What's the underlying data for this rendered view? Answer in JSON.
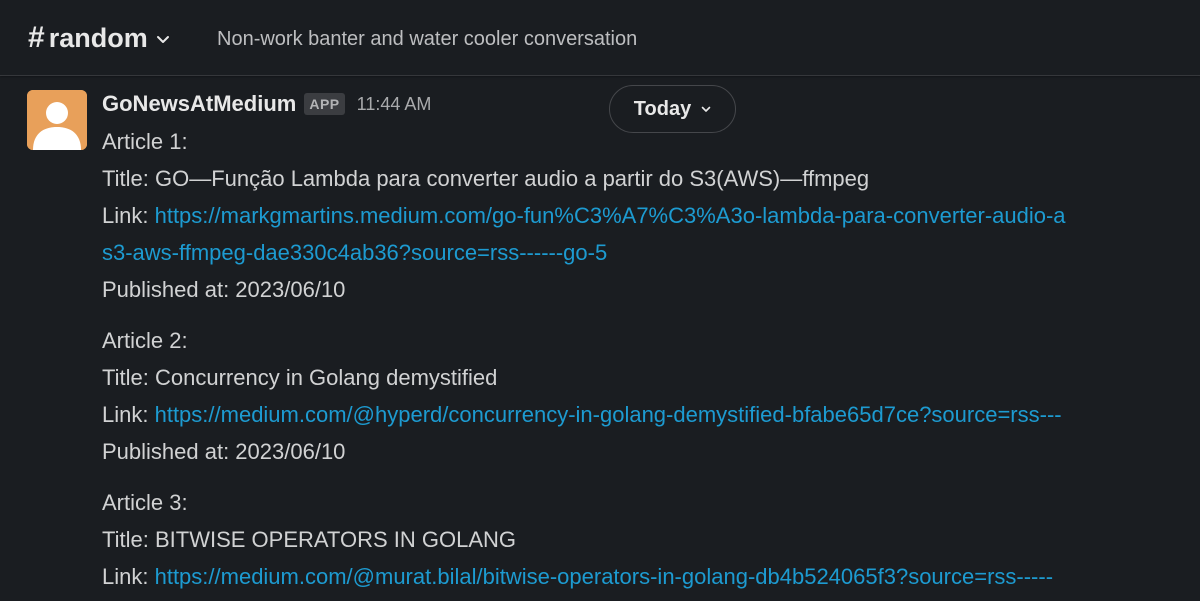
{
  "header": {
    "hash": "#",
    "channel_name": "random",
    "topic": "Non-work banter and water cooler conversation"
  },
  "message": {
    "sender": "GoNewsAtMedium",
    "badge": "APP",
    "time": "11:44 AM",
    "date_divider": "Today",
    "articles": [
      {
        "heading": "Article 1:",
        "title_label": "Title: ",
        "title": "GO—Função Lambda para converter audio a partir do S3(AWS)—ffmpeg",
        "link_label": "Link: ",
        "link": "https://markgmartins.medium.com/go-fun%C3%A7%C3%A3o-lambda-para-converter-audio-a-partir-do-s3-aws-ffmpeg-dae330c4ab36?source=rss------go-5",
        "link_line1": "https://markgmartins.medium.com/go-fun%C3%A7%C3%A3o-lambda-para-converter-audio-a",
        "link_line2": "s3-aws-ffmpeg-dae330c4ab36?source=rss------go-5",
        "published": "Published at: 2023/06/10"
      },
      {
        "heading": "Article 2:",
        "title_label": "Title: ",
        "title": "Concurrency in Golang demystified",
        "link_label": "Link: ",
        "link": "https://medium.com/@hyperd/concurrency-in-golang-demystified-bfabe65d7ce?source=rss---",
        "published": "Published at: 2023/06/10"
      },
      {
        "heading": "Article 3:",
        "title_label": "Title: ",
        "title": "BITWISE OPERATORS IN GOLANG",
        "link_label": "Link: ",
        "link": "https://medium.com/@murat.bilal/bitwise-operators-in-golang-db4b524065f3?source=rss-----"
      }
    ]
  },
  "colors": {
    "background": "#1a1d21",
    "link": "#1d9bd1",
    "avatar_bg": "#e8a05a"
  },
  "icons": {
    "channel_menu": "chevron-down-icon",
    "date_menu": "chevron-down-icon",
    "avatar": "default-user-avatar-icon"
  }
}
